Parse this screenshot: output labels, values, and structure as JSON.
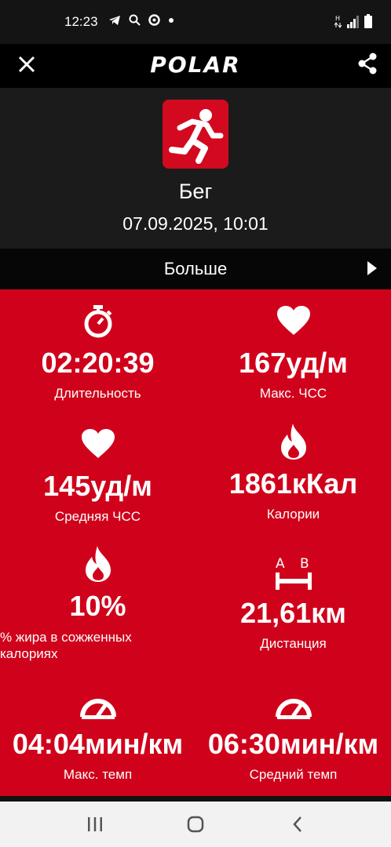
{
  "status": {
    "time": "12:23",
    "icons": [
      "telegram-icon",
      "search-icon",
      "circle-app-icon",
      "dot-icon"
    ],
    "right_icons": [
      "network-icon",
      "signal-icon",
      "battery-icon"
    ]
  },
  "appbar": {
    "logo": "POLAR"
  },
  "activity": {
    "sport": "Бег",
    "datetime": "07.09.2025, 10:01"
  },
  "more": {
    "label": "Больше"
  },
  "stats": [
    {
      "value": "02:20:39",
      "label": "Длительность",
      "icon": "stopwatch-icon"
    },
    {
      "value": "167уд/м",
      "label": "Макс. ЧСС",
      "icon": "heart-icon"
    },
    {
      "value": "145уд/м",
      "label": "Средняя ЧСС",
      "icon": "heart-icon"
    },
    {
      "value": "1861кКал",
      "label": "Калории",
      "icon": "flame-icon"
    },
    {
      "value": "10%",
      "label": "% жира в сожженных калориях",
      "icon": "flame-icon"
    },
    {
      "value": "21,61км",
      "label": "Дистанция",
      "icon": "distance-icon",
      "icon_text": [
        "A",
        "B"
      ]
    },
    {
      "value": "04:04мин/км",
      "label": "Макс. темп",
      "icon": "speedometer-icon"
    },
    {
      "value": "06:30мин/км",
      "label": "Средний темп",
      "icon": "speedometer-icon"
    }
  ],
  "colors": {
    "accent": "#d0021b",
    "background": "#1b1b1b"
  }
}
